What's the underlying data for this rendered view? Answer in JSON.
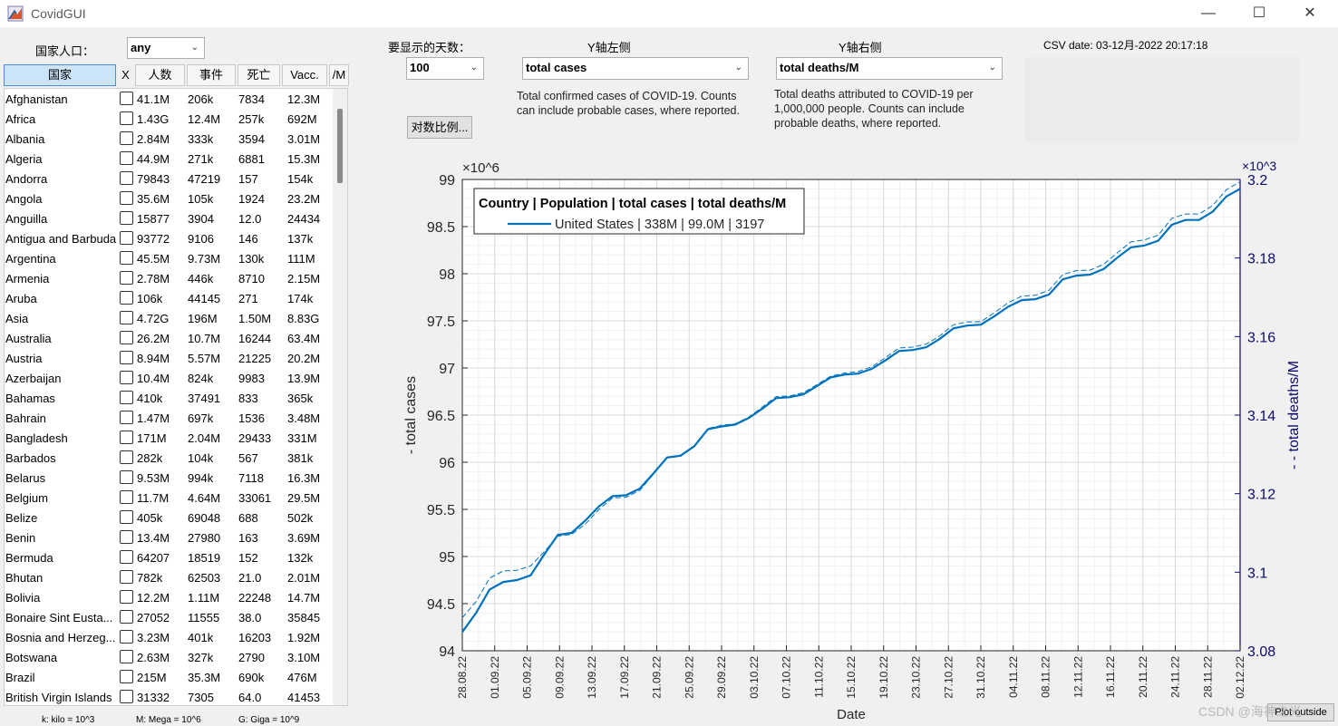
{
  "app": {
    "title": "CovidGUI"
  },
  "window": {
    "minimize": "—",
    "maximize": "☐",
    "close": "✕"
  },
  "filter": {
    "population_label": "国家人口：",
    "population_value": "any"
  },
  "days": {
    "label": "要显示的天数：",
    "value": "100"
  },
  "y_left": {
    "label": "Y轴左侧",
    "value": "total cases",
    "desc_1": "Total confirmed cases of COVID-19. Counts",
    "desc_2": "can include probable cases, where reported."
  },
  "y_right": {
    "label": "Y轴右侧",
    "value": "total deaths/M",
    "desc_1": "Total deaths attributed to COVID-19 per",
    "desc_2": "1,000,000 people. Counts can include",
    "desc_3": "probable deaths, where reported."
  },
  "log_button": "对数比例...",
  "csv_date": "CSV date: 03-12月-2022 20:17:18",
  "table": {
    "headers": {
      "country": "国家",
      "x": "X",
      "population": "人数",
      "cases": "事件",
      "deaths": "死亡",
      "vacc": "Vacc.",
      "per_m": "/M"
    },
    "rows": [
      [
        "Afghanistan",
        "41.1M",
        "206k",
        "7834",
        "12.3M"
      ],
      [
        "Africa",
        "1.43G",
        "12.4M",
        "257k",
        "692M"
      ],
      [
        "Albania",
        "2.84M",
        "333k",
        "3594",
        "3.01M"
      ],
      [
        "Algeria",
        "44.9M",
        "271k",
        "6881",
        "15.3M"
      ],
      [
        "Andorra",
        "79843",
        "47219",
        "157",
        "154k"
      ],
      [
        "Angola",
        "35.6M",
        "105k",
        "1924",
        "23.2M"
      ],
      [
        "Anguilla",
        "15877",
        "3904",
        "12.0",
        "24434"
      ],
      [
        "Antigua and Barbuda",
        "93772",
        "9106",
        "146",
        "137k"
      ],
      [
        "Argentina",
        "45.5M",
        "9.73M",
        "130k",
        "111M"
      ],
      [
        "Armenia",
        "2.78M",
        "446k",
        "8710",
        "2.15M"
      ],
      [
        "Aruba",
        "106k",
        "44145",
        "271",
        "174k"
      ],
      [
        "Asia",
        "4.72G",
        "196M",
        "1.50M",
        "8.83G"
      ],
      [
        "Australia",
        "26.2M",
        "10.7M",
        "16244",
        "63.4M"
      ],
      [
        "Austria",
        "8.94M",
        "5.57M",
        "21225",
        "20.2M"
      ],
      [
        "Azerbaijan",
        "10.4M",
        "824k",
        "9983",
        "13.9M"
      ],
      [
        "Bahamas",
        "410k",
        "37491",
        "833",
        "365k"
      ],
      [
        "Bahrain",
        "1.47M",
        "697k",
        "1536",
        "3.48M"
      ],
      [
        "Bangladesh",
        "171M",
        "2.04M",
        "29433",
        "331M"
      ],
      [
        "Barbados",
        "282k",
        "104k",
        "567",
        "381k"
      ],
      [
        "Belarus",
        "9.53M",
        "994k",
        "7118",
        "16.3M"
      ],
      [
        "Belgium",
        "11.7M",
        "4.64M",
        "33061",
        "29.5M"
      ],
      [
        "Belize",
        "405k",
        "69048",
        "688",
        "502k"
      ],
      [
        "Benin",
        "13.4M",
        "27980",
        "163",
        "3.69M"
      ],
      [
        "Bermuda",
        "64207",
        "18519",
        "152",
        "132k"
      ],
      [
        "Bhutan",
        "782k",
        "62503",
        "21.0",
        "2.01M"
      ],
      [
        "Bolivia",
        "12.2M",
        "1.11M",
        "22248",
        "14.7M"
      ],
      [
        "Bonaire Sint Eusta...",
        "27052",
        "11555",
        "38.0",
        "35845"
      ],
      [
        "Bosnia and Herzeg...",
        "3.23M",
        "401k",
        "16203",
        "1.92M"
      ],
      [
        "Botswana",
        "2.63M",
        "327k",
        "2790",
        "3.10M"
      ],
      [
        "Brazil",
        "215M",
        "35.3M",
        "690k",
        "476M"
      ],
      [
        "British Virgin Islands",
        "31332",
        "7305",
        "64.0",
        "41453"
      ]
    ]
  },
  "footer": {
    "kilo": "k: kilo = 10^3",
    "mega": "M: Mega = 10^6",
    "giga": "G: Giga = 10^9"
  },
  "plot_outside": "Plot outside",
  "watermark": "CSDN @海神之光",
  "chart_data": {
    "type": "line",
    "legend_header": "Country   | Population | total cases | total deaths/M",
    "legend_entry": "United States | 338M | 99.0M | 3197",
    "xlabel": "Date",
    "ylabel_left": "- total cases",
    "ylabel_right": "- - total deaths/M",
    "left_exponent": "×10^6",
    "right_exponent": "×10^3",
    "ylim_left": [
      94,
      99
    ],
    "ylim_right": [
      3.08,
      3.2
    ],
    "yticks_left": [
      "94",
      "94.5",
      "95",
      "95.5",
      "96",
      "96.5",
      "97",
      "97.5",
      "98",
      "98.5",
      "99"
    ],
    "yticks_right": [
      "3.08",
      "3.1",
      "3.12",
      "3.14",
      "3.16",
      "3.18",
      "3.2"
    ],
    "xticks": [
      "28.08.22",
      "01.09.22",
      "05.09.22",
      "09.09.22",
      "13.09.22",
      "17.09.22",
      "21.09.22",
      "25.09.22",
      "29.09.22",
      "03.10.22",
      "07.10.22",
      "11.10.22",
      "15.10.22",
      "19.10.22",
      "23.10.22",
      "27.10.22",
      "31.10.22",
      "04.11.22",
      "08.11.22",
      "12.11.22",
      "16.11.22",
      "20.11.22",
      "24.11.22",
      "28.11.22",
      "02.12.22"
    ],
    "x_start": "28.08.22",
    "x_end": "02.12.22",
    "grid": true,
    "legend_position": "top-left",
    "colors": {
      "line": "#0072bd",
      "right_axis": "#0b0b6e"
    },
    "series": [
      {
        "name": "United States",
        "axis": "left",
        "style": "solid",
        "values": [
          94.2,
          94.4,
          94.65,
          94.73,
          94.75,
          94.8,
          95.02,
          95.23,
          95.25,
          95.38,
          95.53,
          95.64,
          95.65,
          95.72,
          95.88,
          96.05,
          96.07,
          96.17,
          96.35,
          96.38,
          96.4,
          96.47,
          96.57,
          96.68,
          96.69,
          96.72,
          96.81,
          96.9,
          96.93,
          96.94,
          96.99,
          97.08,
          97.18,
          97.19,
          97.22,
          97.31,
          97.42,
          97.45,
          97.46,
          97.55,
          97.65,
          97.72,
          97.73,
          97.78,
          97.94,
          97.98,
          97.99,
          98.05,
          98.17,
          98.28,
          98.3,
          98.35,
          98.52,
          98.57,
          98.57,
          98.66,
          98.82,
          98.9
        ]
      },
      {
        "name": "United States",
        "axis": "right",
        "style": "dashed",
        "values": [
          3.0884,
          3.0925,
          3.0985,
          3.1003,
          3.1005,
          3.1016,
          3.1052,
          3.1092,
          3.1096,
          3.1122,
          3.1159,
          3.1189,
          3.1191,
          3.1208,
          3.1249,
          3.1291,
          3.1295,
          3.1321,
          3.1366,
          3.1374,
          3.1378,
          3.1395,
          3.1421,
          3.1447,
          3.1449,
          3.1457,
          3.1478,
          3.1499,
          3.1507,
          3.1511,
          3.1523,
          3.1546,
          3.1571,
          3.1573,
          3.1581,
          3.1602,
          3.163,
          3.1637,
          3.1638,
          3.1661,
          3.1686,
          3.1703,
          3.1705,
          3.1718,
          3.1758,
          3.1768,
          3.1769,
          3.1784,
          3.1813,
          3.1841,
          3.1846,
          3.1858,
          3.1901,
          3.1912,
          3.1912,
          3.1934,
          3.1974,
          3.1994
        ]
      }
    ]
  }
}
